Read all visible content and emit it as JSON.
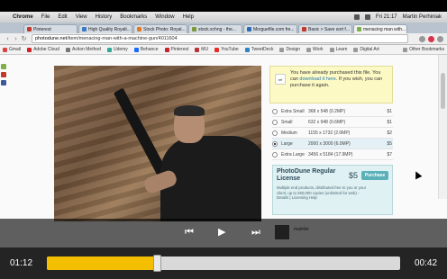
{
  "menubar": {
    "apple": "",
    "items": [
      "Chrome",
      "File",
      "Edit",
      "View",
      "History",
      "Bookmarks",
      "Window",
      "Help"
    ],
    "clock": "Fri 21:17",
    "user": "Martin Perhiniak"
  },
  "tabs": [
    {
      "label": "Pinterest"
    },
    {
      "label": "High Quality Royalt..."
    },
    {
      "label": "Stock Photo: Royal..."
    },
    {
      "label": "stock.xchng - the..."
    },
    {
      "label": "Morguefile.com fre..."
    },
    {
      "label": "Basic > Save sort f..."
    },
    {
      "label": "menacing man with..."
    }
  ],
  "address": {
    "domain": "photodune.net",
    "path": "/item/menacing-man-with-a-machine-gun/4011604"
  },
  "bookmarks": [
    "Gmail",
    "Adobe Cloud",
    "Action Method",
    "Udemy",
    "Behance",
    "Pinterest",
    "MU",
    "YouTube",
    "TweetDeck",
    "Design",
    "Work",
    "Learn",
    "Digital Art"
  ],
  "bookmarks_right": "Other Bookmarks",
  "purchase_notice": {
    "badge": "ref",
    "text_before": "You have already purchased this file. You can",
    "link": "download it here",
    "text_after": ". If you wish, you can purchase it again."
  },
  "sizes": [
    {
      "name": "Extra Small",
      "dims": "368 x 548 (0.2MP)",
      "price": "$1",
      "selected": false
    },
    {
      "name": "Small",
      "dims": "632 x 948 (0.6MP)",
      "price": "$1",
      "selected": false
    },
    {
      "name": "Medium",
      "dims": "1155 x 1732 (2.0MP)",
      "price": "$2",
      "selected": false
    },
    {
      "name": "Large",
      "dims": "2000 x 3000 (6.0MP)",
      "price": "$5",
      "selected": true
    },
    {
      "name": "Extra Large",
      "dims": "3456 x 5184 (17.9MP)",
      "price": "$7",
      "selected": false
    }
  ],
  "license": {
    "title": "PhotoDune Regular License",
    "price": "$5",
    "buy": "Purchase",
    "desc": "Multiple end products, distributed free to you or your client, up to 250,000 copies (unlimited for web) - Details | Licensing Help"
  },
  "author": "maimbr",
  "player": {
    "elapsed": "01:12",
    "remaining": "00:42",
    "progress": 0.31,
    "prev_icon": "⏮",
    "play_icon": "▶",
    "next_icon": "⏭"
  }
}
